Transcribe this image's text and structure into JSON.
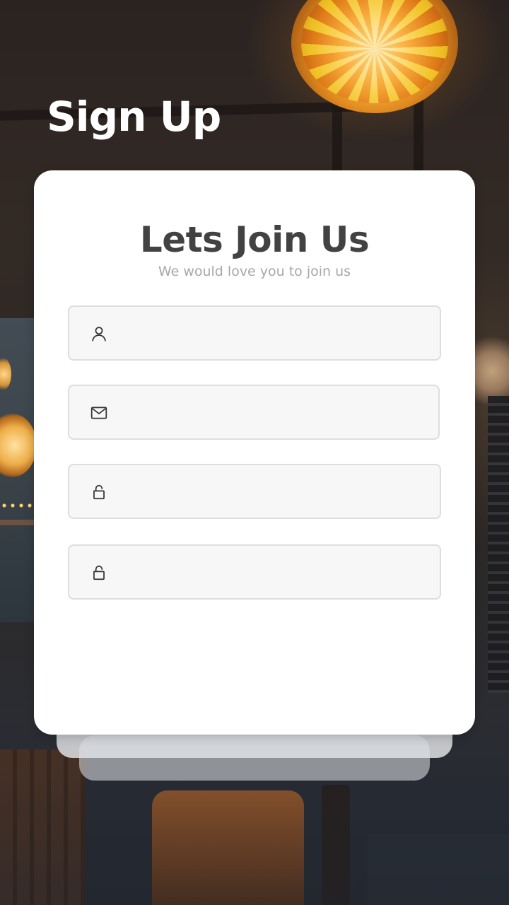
{
  "page": {
    "title": "Sign Up"
  },
  "card": {
    "heading": "Lets Join Us",
    "subtitle": "We would love you to join us"
  },
  "form": {
    "fields": [
      {
        "icon": "user-icon",
        "value": "",
        "placeholder": ""
      },
      {
        "icon": "mail-icon",
        "value": "",
        "placeholder": ""
      },
      {
        "icon": "lock-icon",
        "value": "",
        "placeholder": ""
      },
      {
        "icon": "lock-icon",
        "value": "",
        "placeholder": ""
      }
    ]
  },
  "colors": {
    "title_text": "#ffffff",
    "card_background": "#ffffff",
    "heading_text": "#424242",
    "subtitle_text": "#a7a7a7",
    "field_background": "#f7f7f7",
    "field_border": "#dedede",
    "icon_stroke": "#333333"
  }
}
